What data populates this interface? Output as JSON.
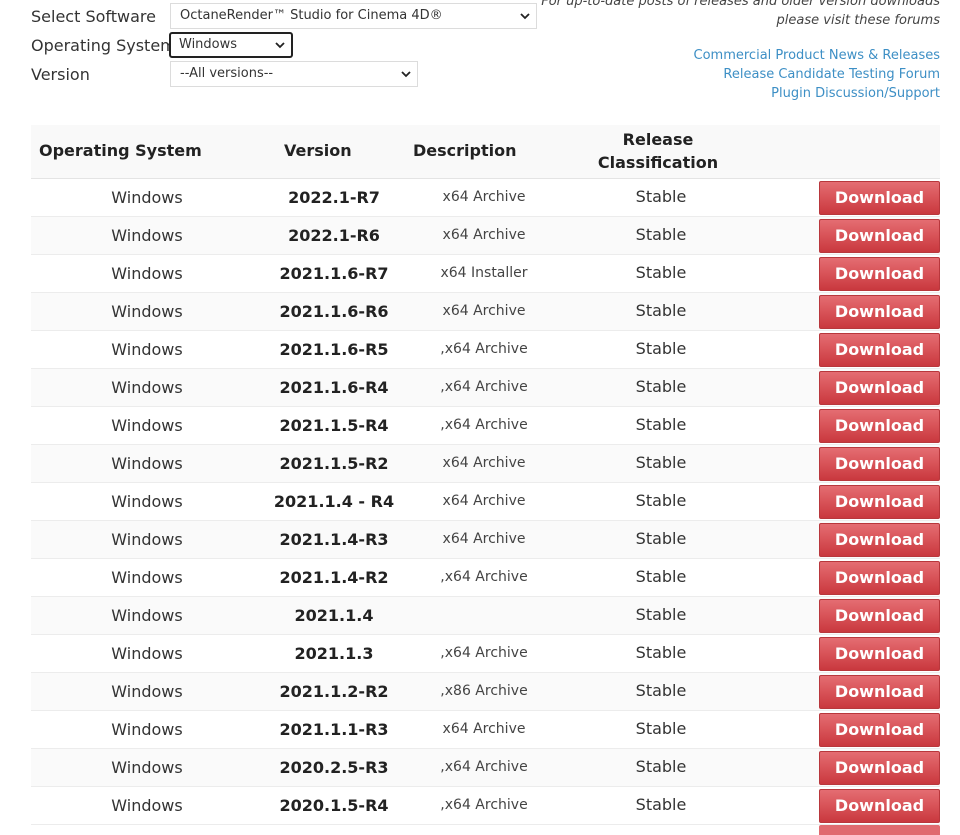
{
  "filters": {
    "software": {
      "label": "Select Software",
      "value": "OctaneRender™ Studio for Cinema 4D®"
    },
    "os": {
      "label": "Operating System",
      "value": "Windows"
    },
    "version": {
      "label": "Version",
      "value": "--All versions--"
    }
  },
  "info": {
    "line1": "For up-to-date posts of releases and older version downloads",
    "line2": "please visit these forums"
  },
  "forum_links": [
    "Commercial Product News & Releases",
    "Release Candidate Testing Forum",
    "Plugin Discussion/Support"
  ],
  "table": {
    "headers": {
      "os": "Operating System",
      "version": "Version",
      "description": "Description",
      "release_line1": "Release",
      "release_line2": "Classification"
    },
    "rows": [
      {
        "os": "Windows",
        "version": "2022.1-R7",
        "description": "x64 Archive",
        "release": "Stable",
        "action": "Download"
      },
      {
        "os": "Windows",
        "version": "2022.1-R6",
        "description": "x64 Archive",
        "release": "Stable",
        "action": "Download"
      },
      {
        "os": "Windows",
        "version": "2021.1.6-R7",
        "description": "x64 Installer",
        "release": "Stable",
        "action": "Download"
      },
      {
        "os": "Windows",
        "version": "2021.1.6-R6",
        "description": "x64 Archive",
        "release": "Stable",
        "action": "Download"
      },
      {
        "os": "Windows",
        "version": "2021.1.6-R5",
        "description": ",x64 Archive",
        "release": "Stable",
        "action": "Download"
      },
      {
        "os": "Windows",
        "version": "2021.1.6-R4",
        "description": ",x64 Archive",
        "release": "Stable",
        "action": "Download"
      },
      {
        "os": "Windows",
        "version": "2021.1.5-R4",
        "description": ",x64 Archive",
        "release": "Stable",
        "action": "Download"
      },
      {
        "os": "Windows",
        "version": "2021.1.5-R2",
        "description": "x64 Archive",
        "release": "Stable",
        "action": "Download"
      },
      {
        "os": "Windows",
        "version": "2021.1.4 - R4",
        "description": "x64 Archive",
        "release": "Stable",
        "action": "Download"
      },
      {
        "os": "Windows",
        "version": "2021.1.4-R3",
        "description": "x64 Archive",
        "release": "Stable",
        "action": "Download"
      },
      {
        "os": "Windows",
        "version": "2021.1.4-R2",
        "description": ",x64 Archive",
        "release": "Stable",
        "action": "Download"
      },
      {
        "os": "Windows",
        "version": "2021.1.4",
        "description": "",
        "release": "Stable",
        "action": "Download"
      },
      {
        "os": "Windows",
        "version": "2021.1.3",
        "description": ",x64 Archive",
        "release": "Stable",
        "action": "Download"
      },
      {
        "os": "Windows",
        "version": "2021.1.2-R2",
        "description": ",x86 Archive",
        "release": "Stable",
        "action": "Download"
      },
      {
        "os": "Windows",
        "version": "2021.1.1-R3",
        "description": "x64 Archive",
        "release": "Stable",
        "action": "Download"
      },
      {
        "os": "Windows",
        "version": "2020.2.5-R3",
        "description": ",x64 Archive",
        "release": "Stable",
        "action": "Download"
      },
      {
        "os": "Windows",
        "version": "2020.1.5-R4",
        "description": ",x64 Archive",
        "release": "Stable",
        "action": "Download"
      }
    ]
  }
}
